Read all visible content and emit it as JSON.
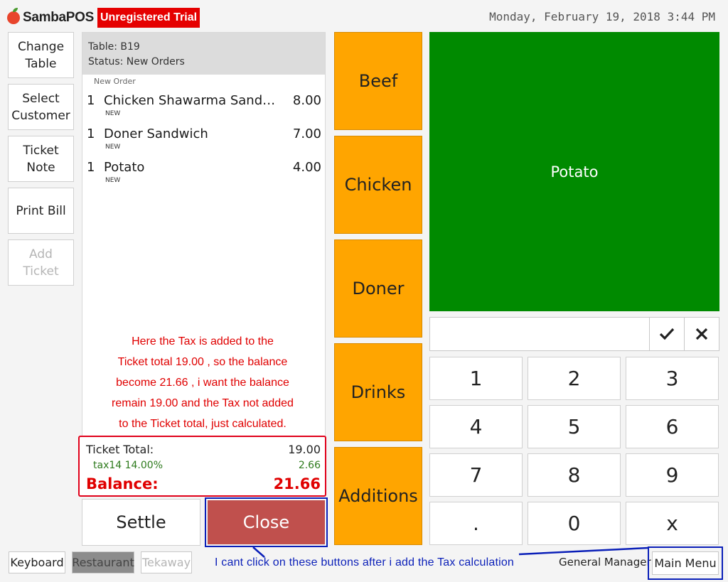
{
  "header": {
    "app_name": "SambaPOS",
    "trial_badge": "Unregistered Trial",
    "datetime": "Monday, February 19, 2018 3:44 PM"
  },
  "left_actions": [
    {
      "label": "Change\nTable",
      "enabled": true
    },
    {
      "label": "Select\nCustomer",
      "enabled": true
    },
    {
      "label": "Ticket\nNote",
      "enabled": true
    },
    {
      "label": "Print Bill",
      "enabled": true
    },
    {
      "label": "Add\nTicket",
      "enabled": false
    }
  ],
  "ticket": {
    "table": "Table: B19",
    "status": "Status: New Orders",
    "group_label": "New Order",
    "orders": [
      {
        "qty": "1",
        "name": "Chicken Shawarma Sandwich",
        "price": "8.00",
        "state": "NEW"
      },
      {
        "qty": "1",
        "name": "Doner Sandwich",
        "price": "7.00",
        "state": "NEW"
      },
      {
        "qty": "1",
        "name": "Potato",
        "price": "4.00",
        "state": "NEW"
      }
    ],
    "totals": {
      "ticket_total_label": "Ticket Total:",
      "ticket_total_value": "19.00",
      "tax_label": "tax14 14.00%",
      "tax_value": "2.66",
      "balance_label": "Balance:",
      "balance_value": "21.66"
    },
    "settle_label": "Settle",
    "close_label": "Close"
  },
  "annotation": {
    "text": "Here the Tax is added to the\nTicket total 19.00 , so the balance\nbecome 21.66 , i want the balance\nremain 19.00 and the Tax not added\nto the Ticket total, just calculated.",
    "bottom_note": "I cant click on these buttons after i add the Tax calculation"
  },
  "categories": [
    "Beef",
    "Chicken",
    "Doner",
    "Drinks",
    "Additions"
  ],
  "products": [
    {
      "name": "Potato",
      "color": "#008a00"
    }
  ],
  "numpad": {
    "input_value": "",
    "confirm_icon": "check-icon",
    "clear_icon": "cross-icon",
    "keys": [
      "1",
      "2",
      "3",
      "4",
      "5",
      "6",
      "7",
      "8",
      "9",
      ".",
      "0",
      "x"
    ]
  },
  "bottom_bar": {
    "keyboard": "Keyboard",
    "restaurant": "Restaurant",
    "takeaway": "Tekaway",
    "user": "General Manager",
    "main_menu": "Main Menu"
  },
  "colors": {
    "category": "#ffa500",
    "product": "#008a00",
    "close_button": "#c0504d",
    "annotation": "#e00000",
    "highlight_box": "#0a1fb8"
  }
}
